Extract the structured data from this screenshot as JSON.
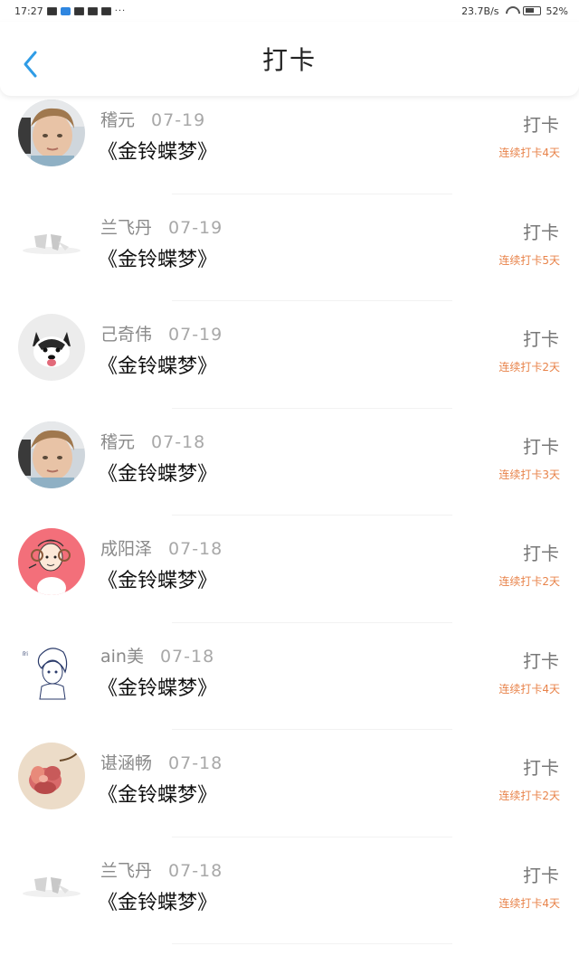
{
  "status_bar": {
    "time": "17:27",
    "speed": "23.7B/s",
    "battery": "52%",
    "dots": "···"
  },
  "header": {
    "title": "打卡",
    "accent_color": "#2f9ce6"
  },
  "checkin_label": "打卡",
  "items": [
    {
      "name": "稽元",
      "date": "07-19",
      "book": "《金铃蝶梦》",
      "streak": "连续打卡4天",
      "avatar": "boy-photo"
    },
    {
      "name": "兰飞丹",
      "date": "07-19",
      "book": "《金铃蝶梦》",
      "streak": "连续打卡5天",
      "avatar": "sketch-logo"
    },
    {
      "name": "己奇伟",
      "date": "07-19",
      "book": "《金铃蝶梦》",
      "streak": "连续打卡2天",
      "avatar": "husky-dog"
    },
    {
      "name": "稽元",
      "date": "07-18",
      "book": "《金铃蝶梦》",
      "streak": "连续打卡3天",
      "avatar": "boy-photo"
    },
    {
      "name": "成阳泽",
      "date": "07-18",
      "book": "《金铃蝶梦》",
      "streak": "连续打卡2天",
      "avatar": "cartoon-sheep"
    },
    {
      "name": "ain美",
      "date": "07-18",
      "book": "《金铃蝶梦》",
      "streak": "连续打卡4天",
      "avatar": "anime-sketch"
    },
    {
      "name": "谌涵畅",
      "date": "07-18",
      "book": "《金铃蝶梦》",
      "streak": "连续打卡2天",
      "avatar": "pink-flower"
    },
    {
      "name": "兰飞丹",
      "date": "07-18",
      "book": "《金铃蝶梦》",
      "streak": "连续打卡4天",
      "avatar": "sketch-logo"
    }
  ],
  "colors": {
    "streak": "#e8834a",
    "name": "#8a8a8a",
    "book": "#111111"
  }
}
